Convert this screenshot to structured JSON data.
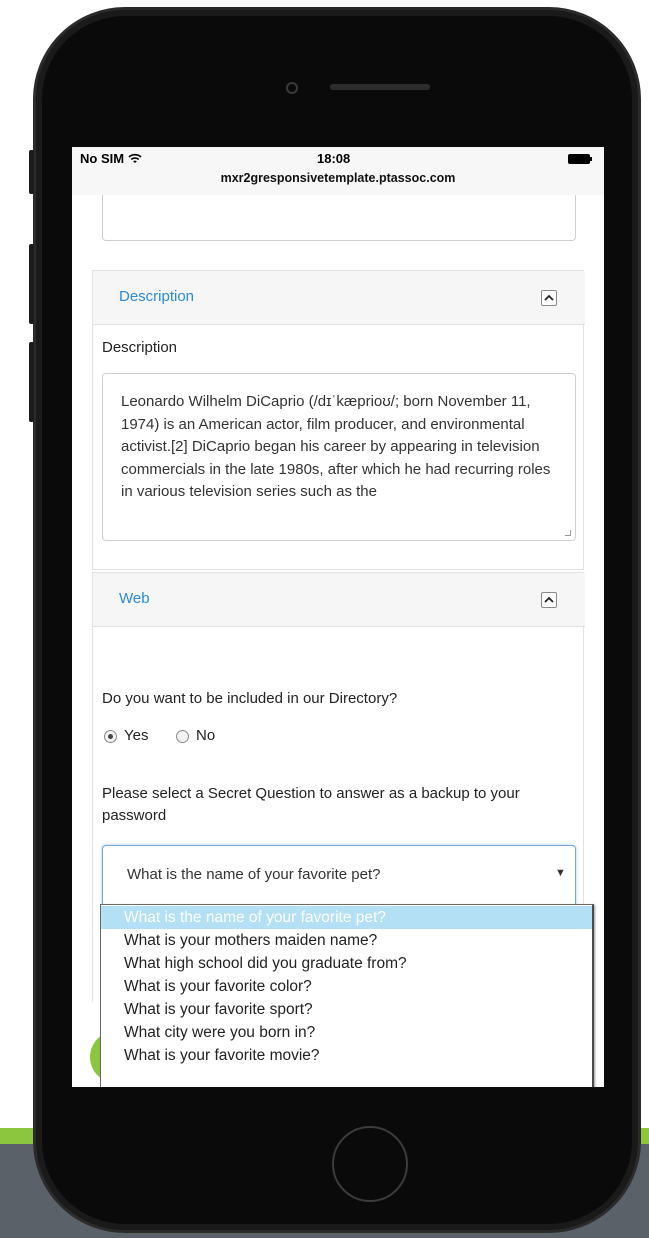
{
  "status_bar": {
    "carrier": "No SIM",
    "time": "18:08",
    "url": "mxr2gresponsivetemplate.ptassoc.com"
  },
  "description_panel": {
    "header": "Description",
    "field_label": "Description",
    "text": "Leonardo Wilhelm DiCaprio (/dɪˈkæprioʊ/; born November 11, 1974) is an American actor, film producer, and environmental activist.[2] DiCaprio began his career by appearing in television commercials in the late 1980s, after which he had recurring roles in various television series such as the"
  },
  "web_panel": {
    "header": "Web",
    "directory_question": "Do you want to be included in our Directory?",
    "radio_yes": "Yes",
    "radio_no": "No",
    "selected_radio": "Yes",
    "secret_question_label": "Please select a Secret Question to answer as a backup to your password",
    "secret_question_value": "What is the name of your favorite pet?",
    "secret_question_options": [
      "What is the name of your favorite pet?",
      "What is your mothers maiden name?",
      "What high school did you graduate from?",
      "What is your favorite color?",
      "What is your favorite sport?",
      "What city were you born in?",
      "What is your favorite movie?"
    ]
  },
  "colors": {
    "accent_link": "#2a8ad4",
    "brand_green": "#8cc63f",
    "dropdown_highlight": "#b3e0f5"
  },
  "icons": {
    "wifi": "wifi-icon",
    "battery": "battery-icon",
    "collapse": "chevron-up-icon",
    "select_arrow": "caret-down-icon"
  }
}
